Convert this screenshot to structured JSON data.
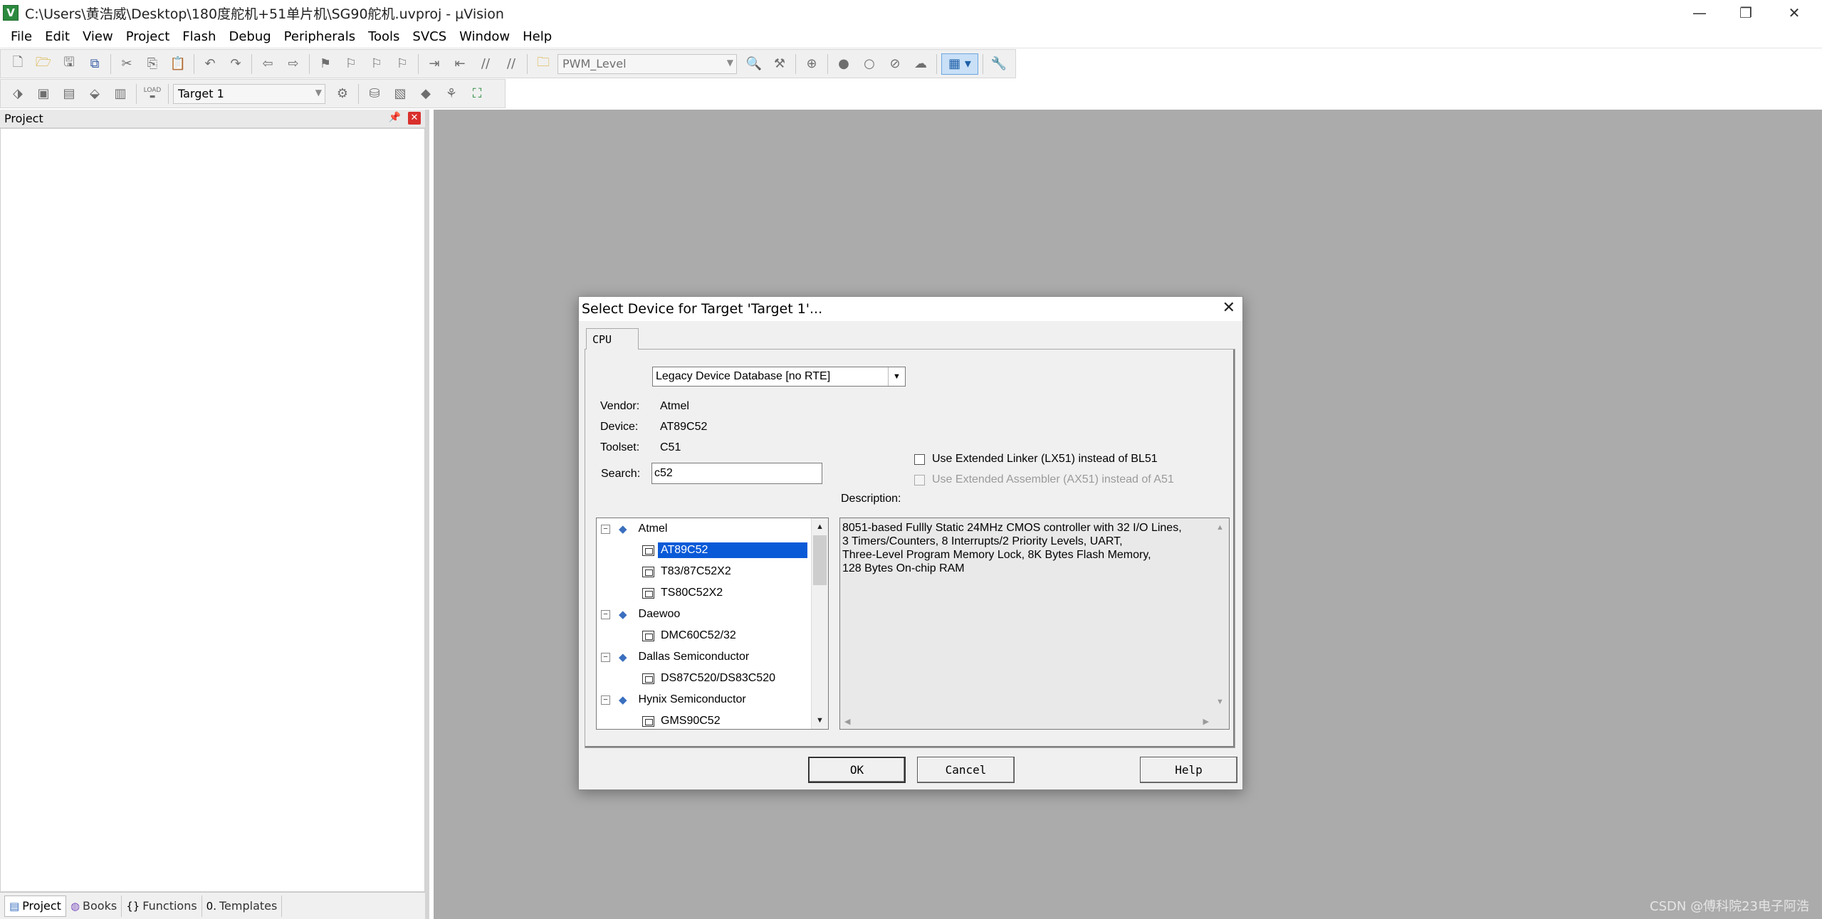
{
  "window": {
    "title": "C:\\Users\\黄浩威\\Desktop\\180度舵机+51单片机\\SG90舵机.uvproj - µVision",
    "icon_letter": "V",
    "controls": {
      "minimize": "—",
      "restore": "❐",
      "close": "✕"
    }
  },
  "menu": [
    "File",
    "Edit",
    "View",
    "Project",
    "Flash",
    "Debug",
    "Peripherals",
    "Tools",
    "SVCS",
    "Window",
    "Help"
  ],
  "toolbar1": {
    "combo_value": "PWM_Level"
  },
  "toolbar2": {
    "load_label": "LOAD",
    "target_value": "Target 1"
  },
  "project_pane": {
    "title": "Project",
    "tabs": [
      {
        "label": "Project",
        "icon": "▤"
      },
      {
        "label": "Books",
        "icon": "◍"
      },
      {
        "label": "Functions",
        "icon": "{}"
      },
      {
        "label": "Templates",
        "icon": "0."
      }
    ]
  },
  "dialog": {
    "title": "Select Device for Target 'Target 1'...",
    "tab": "CPU",
    "database": "Legacy Device Database [no RTE]",
    "vendor_label": "Vendor:",
    "vendor_value": "Atmel",
    "device_label": "Device:",
    "device_value": "AT89C52",
    "toolset_label": "Toolset:",
    "toolset_value": "C51",
    "search_label": "Search:",
    "search_value": "c52",
    "linker_label": "Use Extended Linker (LX51) instead of BL51",
    "assembler_label": "Use Extended Assembler (AX51) instead of A51",
    "description_label": "Description:",
    "description_lines": [
      "8051-based Fullly Static 24MHz CMOS controller with 32  I/O Lines,",
      "3 Timers/Counters, 8 Interrupts/2 Priority Levels, UART,",
      "Three-Level Program Memory Lock, 8K Bytes Flash Memory,",
      "128 Bytes On-chip RAM"
    ],
    "tree": [
      {
        "kind": "vendor",
        "label": "Atmel"
      },
      {
        "kind": "device",
        "label": "AT89C52",
        "selected": true
      },
      {
        "kind": "device",
        "label": "T83/87C52X2"
      },
      {
        "kind": "device",
        "label": "TS80C52X2"
      },
      {
        "kind": "vendor",
        "label": "Daewoo"
      },
      {
        "kind": "device",
        "label": "DMC60C52/32"
      },
      {
        "kind": "vendor",
        "label": "Dallas Semiconductor"
      },
      {
        "kind": "device",
        "label": "DS87C520/DS83C520"
      },
      {
        "kind": "vendor",
        "label": "Hynix Semiconductor"
      },
      {
        "kind": "device",
        "label": "GMS90C52"
      }
    ],
    "buttons": {
      "ok": "OK",
      "cancel": "Cancel",
      "help": "Help"
    }
  },
  "watermark": "CSDN @傅科院23电子阿浩",
  "colors": {
    "workspace": "#ababab",
    "selection": "#0a5ad8",
    "close_red": "#d9302c"
  }
}
